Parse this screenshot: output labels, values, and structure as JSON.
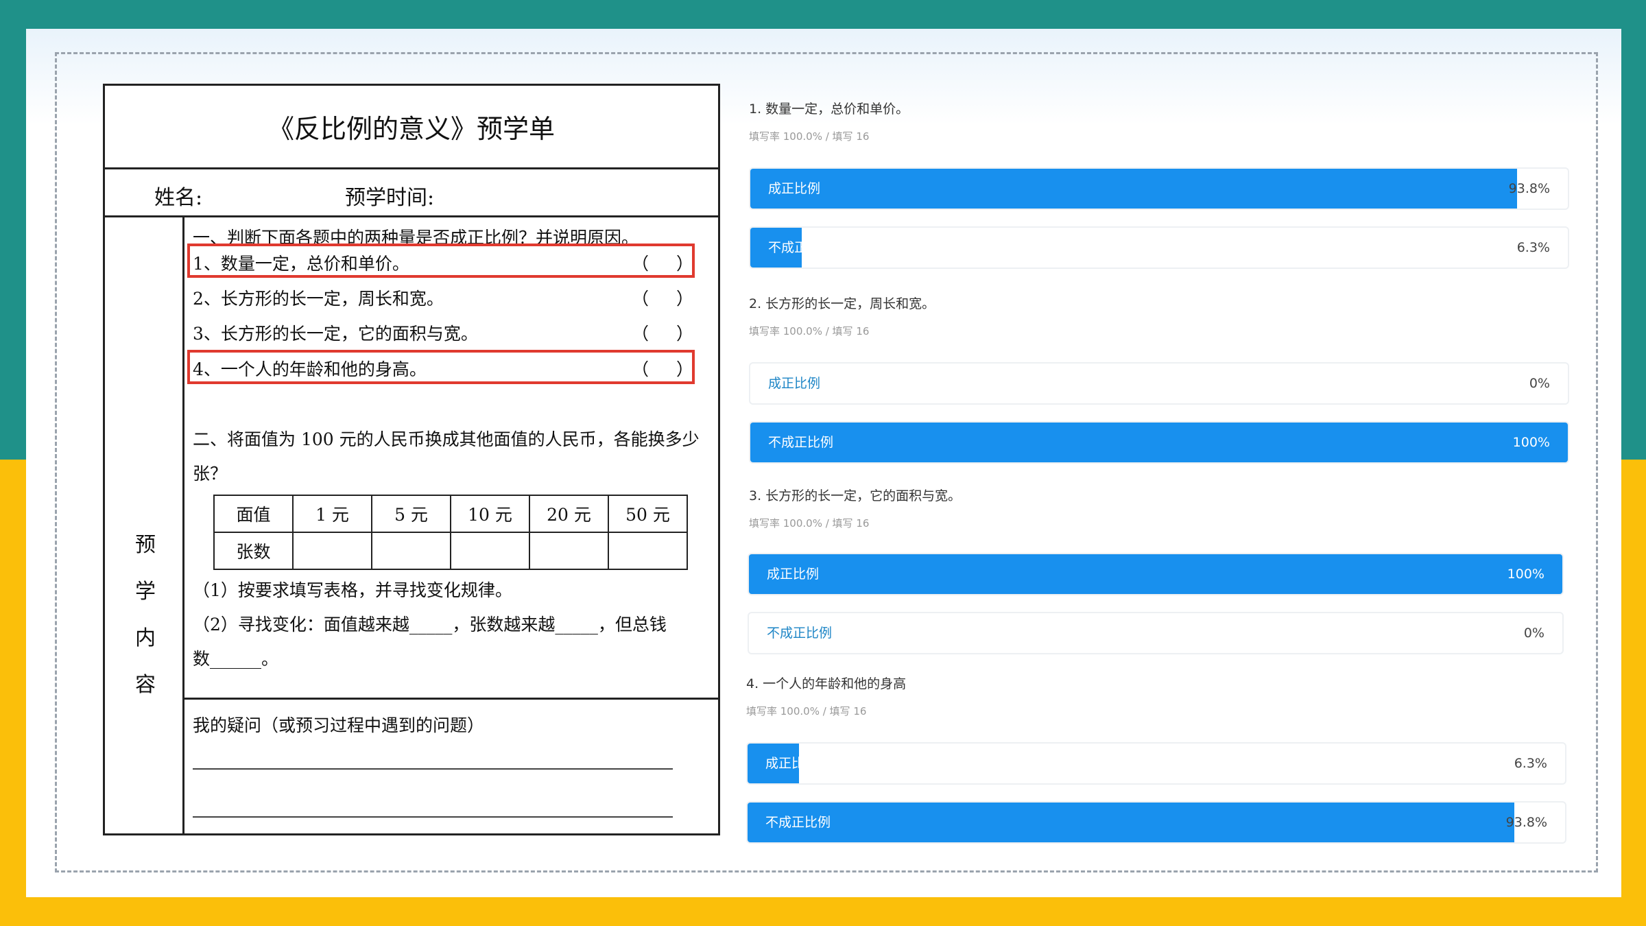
{
  "worksheet": {
    "title": "《反比例的意义》预学单",
    "name_label": "姓名:",
    "time_label": "预学时间:",
    "side_label": [
      "预",
      "学",
      "内",
      "容"
    ],
    "section1_heading": "一、判断下面各题中的两种量是否成正比例？并说明原因。",
    "items": [
      "1、数量一定，总价和单价。",
      "2、长方形的长一定，周长和宽。",
      "3、长方形的长一定，它的面积与宽。",
      "4、一个人的年龄和他的身高。"
    ],
    "paren_open": "（",
    "paren_close": "）",
    "section2_line1": "二、将面值为 100 元的人民币换成其他面值的人民币，各能换多少",
    "section2_line2": "张？",
    "table_header": [
      "面值",
      "1 元",
      "5 元",
      "10 元",
      "20 元",
      "50 元"
    ],
    "table_row_label": "张数",
    "task1": "（1）按要求填写表格，并寻找变化规律。",
    "task2_line1": "（2）寻找变化：面值越来越_____，张数越来越_____，但总钱",
    "task2_line2": "数______。",
    "question_label": "我的疑问（或预习过程中遇到的问题）"
  },
  "survey": {
    "questions": [
      {
        "title": "1. 数量一定，总价和单价。",
        "meta": "填写率 100.0% / 填写 16",
        "options": [
          {
            "label": "成正比例",
            "percent": "93.8%",
            "value": 0.938
          },
          {
            "label": "不成正比例",
            "percent": "6.3%",
            "value": 0.063
          }
        ]
      },
      {
        "title": "2. 长方形的长一定，周长和宽。",
        "meta": "填写率 100.0% / 填写 16",
        "options": [
          {
            "label": "成正比例",
            "percent": "0%",
            "value": 0
          },
          {
            "label": "不成正比例",
            "percent": "100%",
            "value": 1
          }
        ]
      },
      {
        "title": "3. 长方形的长一定，它的面积与宽。",
        "meta": "填写率 100.0% / 填写 16",
        "options": [
          {
            "label": "成正比例",
            "percent": "100%",
            "value": 1
          },
          {
            "label": "不成正比例",
            "percent": "0%",
            "value": 0
          }
        ]
      },
      {
        "title": "4. 一个人的年龄和他的身高",
        "meta": "填写率 100.0% / 填写 16",
        "options": [
          {
            "label": "成正比例",
            "percent": "6.3%",
            "value": 0.063
          },
          {
            "label": "不成正比例",
            "percent": "93.8%",
            "value": 0.938
          }
        ]
      }
    ]
  },
  "colors": {
    "teal": "#1f9189",
    "yellow": "#fbbf0a",
    "bar_blue": "#1890ee",
    "highlight_red": "#e03a2f"
  }
}
